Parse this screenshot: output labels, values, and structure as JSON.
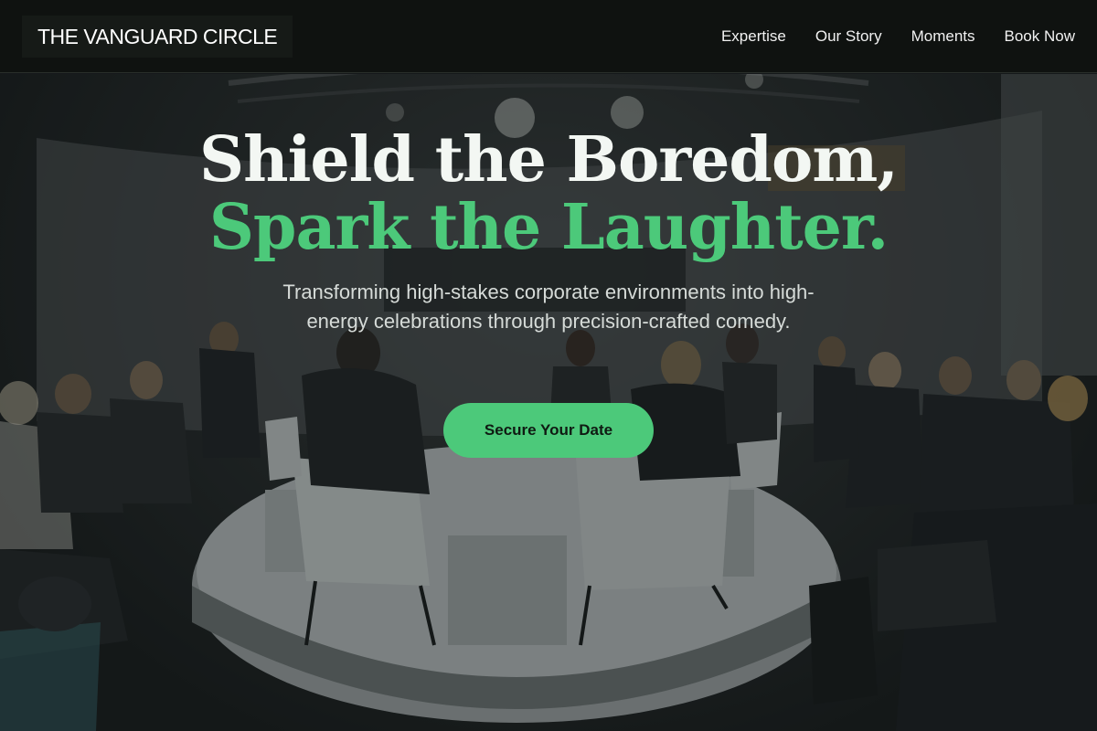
{
  "header": {
    "logo": "THE VANGUARD CIRCLE",
    "nav": [
      {
        "label": "Expertise"
      },
      {
        "label": "Our Story"
      },
      {
        "label": "Moments"
      },
      {
        "label": "Book Now"
      }
    ]
  },
  "hero": {
    "headline_line1": "Shield the Boredom,",
    "headline_line2": "Spark the Laughter.",
    "subtitle": "Transforming high-stakes corporate environments into high-energy celebrations through precision-crafted comedy.",
    "cta_label": "Secure Your Date",
    "background_image": "conference-panel-photo"
  },
  "colors": {
    "accent": "#4cc97a",
    "header_bg": "#0f1210",
    "headline_text": "#f3f7f3",
    "subtitle_text": "#d6dbd8"
  }
}
